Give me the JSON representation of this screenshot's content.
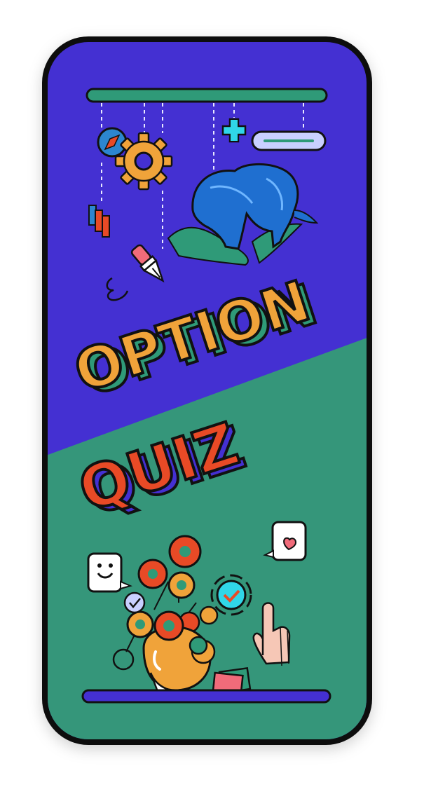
{
  "screen": {
    "title_top": "OPTION",
    "title_bottom": "QUIZ"
  },
  "colors": {
    "frame": "#111111",
    "top_background": "#4430d2",
    "bottom_background": "#35967a",
    "option_text": "#f0a33a",
    "quiz_text": "#e84a26",
    "accent_green": "#2f9a78",
    "accent_cyan": "#30d6e8",
    "accent_orange": "#f0a33a",
    "accent_red": "#e84a26"
  },
  "icons": [
    "compass-icon",
    "gear-icon",
    "plus-icon",
    "slider-pill-icon",
    "bookmark-tags-icon",
    "bull-illustration",
    "pen-nib-icon",
    "smiley-chat-icon",
    "heart-chat-icon",
    "check-badge-icon",
    "small-check-badge-icon",
    "pointing-hand-icon",
    "flower-vase-illustration",
    "sticky-note-icon"
  ]
}
